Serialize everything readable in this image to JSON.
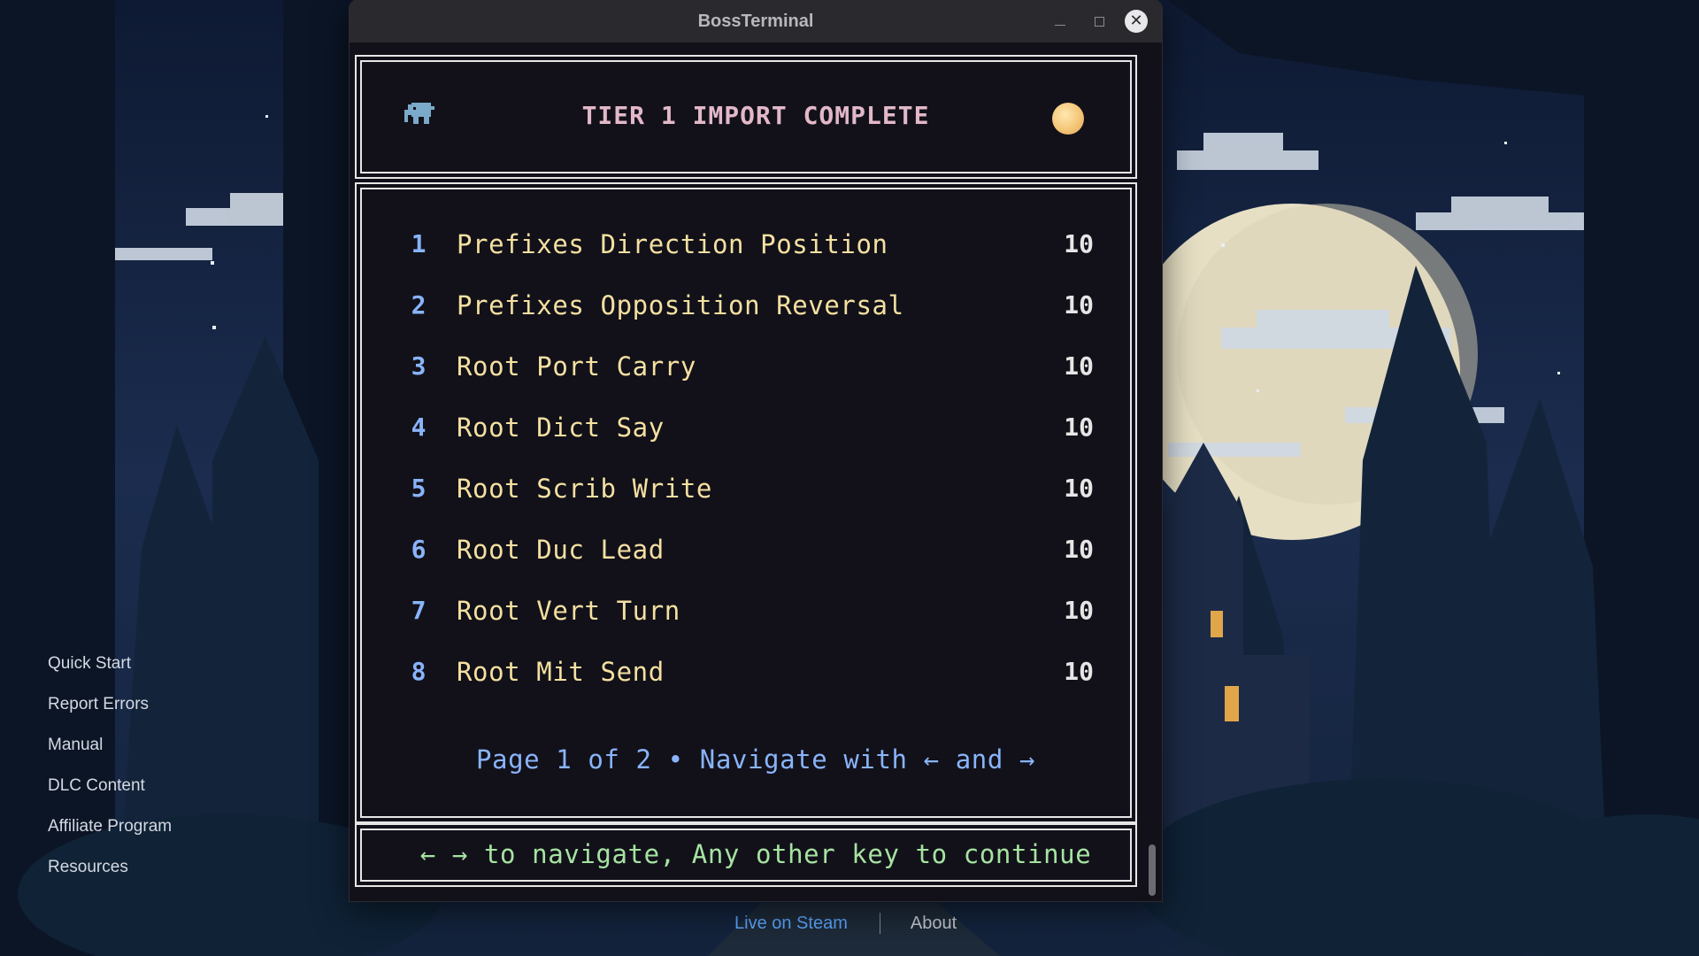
{
  "window": {
    "title": "BossTerminal",
    "controls": [
      "minimize-icon",
      "maximize-icon",
      "close-icon"
    ],
    "close_glyph": "✕"
  },
  "terminal": {
    "header": {
      "icon": "elephant-icon",
      "title": "TIER 1 IMPORT COMPLETE",
      "right_icon": "moon-icon"
    },
    "items": [
      {
        "num": "1",
        "name": "Prefixes Direction Position",
        "score": "10"
      },
      {
        "num": "2",
        "name": "Prefixes Opposition Reversal",
        "score": "10"
      },
      {
        "num": "3",
        "name": "Root Port Carry",
        "score": "10"
      },
      {
        "num": "4",
        "name": "Root Dict Say",
        "score": "10"
      },
      {
        "num": "5",
        "name": "Root Scrib Write",
        "score": "10"
      },
      {
        "num": "6",
        "name": "Root Duc Lead",
        "score": "10"
      },
      {
        "num": "7",
        "name": "Root Vert Turn",
        "score": "10"
      },
      {
        "num": "8",
        "name": "Root Mit Send",
        "score": "10"
      }
    ],
    "page_info": "Page 1 of 2 • Navigate with ← and →",
    "footer": "← → to navigate, Any other key to continue"
  },
  "side_menu": [
    "Quick Start",
    "Report Errors",
    "Manual",
    "DLC Content",
    "Affiliate Program",
    "Resources"
  ],
  "bottom_links": {
    "steam": "Live on Steam",
    "about": "About"
  },
  "colors": {
    "header_title": "#e2b8c8",
    "item_number": "#89b4fa",
    "item_name": "#f4e0a0",
    "score": "#e6e6e6",
    "page_info": "#89b4fa",
    "footer": "#a6e3a1",
    "terminal_bg": "#12111a",
    "link_accent": "#5ca8ff"
  }
}
